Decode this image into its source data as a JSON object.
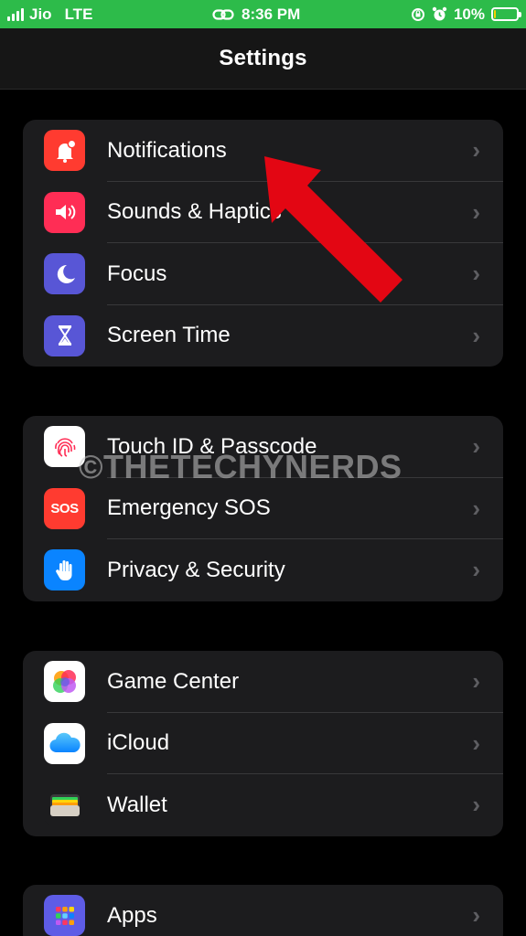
{
  "status_bar": {
    "carrier": "Jio",
    "network": "LTE",
    "time": "8:36 PM",
    "battery_percent": "10%",
    "battery_level": 0.1,
    "colors": {
      "background": "#2dbb4a",
      "battery_fill": "#f4d000"
    }
  },
  "header": {
    "title": "Settings"
  },
  "groups": [
    {
      "items": [
        {
          "label": "Notifications",
          "icon": "bell-icon",
          "color": "#ff3b30"
        },
        {
          "label": "Sounds & Haptics",
          "icon": "speaker-icon",
          "color": "#ff2d55"
        },
        {
          "label": "Focus",
          "icon": "moon-icon",
          "color": "#5856d6"
        },
        {
          "label": "Screen Time",
          "icon": "hourglass-icon",
          "color": "#5856d6"
        }
      ]
    },
    {
      "items": [
        {
          "label": "Touch ID & Passcode",
          "icon": "fingerprint-icon",
          "color": "#ffffff"
        },
        {
          "label": "Emergency SOS",
          "icon": "sos-icon",
          "icon_text": "SOS",
          "color": "#ff3b30"
        },
        {
          "label": "Privacy & Security",
          "icon": "hand-icon",
          "color": "#0a84ff"
        }
      ]
    },
    {
      "items": [
        {
          "label": "Game Center",
          "icon": "game-center-icon",
          "color": "#ffffff"
        },
        {
          "label": "iCloud",
          "icon": "cloud-icon",
          "color": "#ffffff"
        },
        {
          "label": "Wallet",
          "icon": "wallet-icon",
          "color": "#1c1c1e"
        }
      ]
    },
    {
      "items": [
        {
          "label": "Apps",
          "icon": "apps-grid-icon",
          "color": "#5e5ce6"
        }
      ]
    }
  ],
  "chevron": "›",
  "watermark": "©THETECHYNERDS",
  "annotation": {
    "icon": "red-arrow-icon",
    "color": "#e30613"
  }
}
